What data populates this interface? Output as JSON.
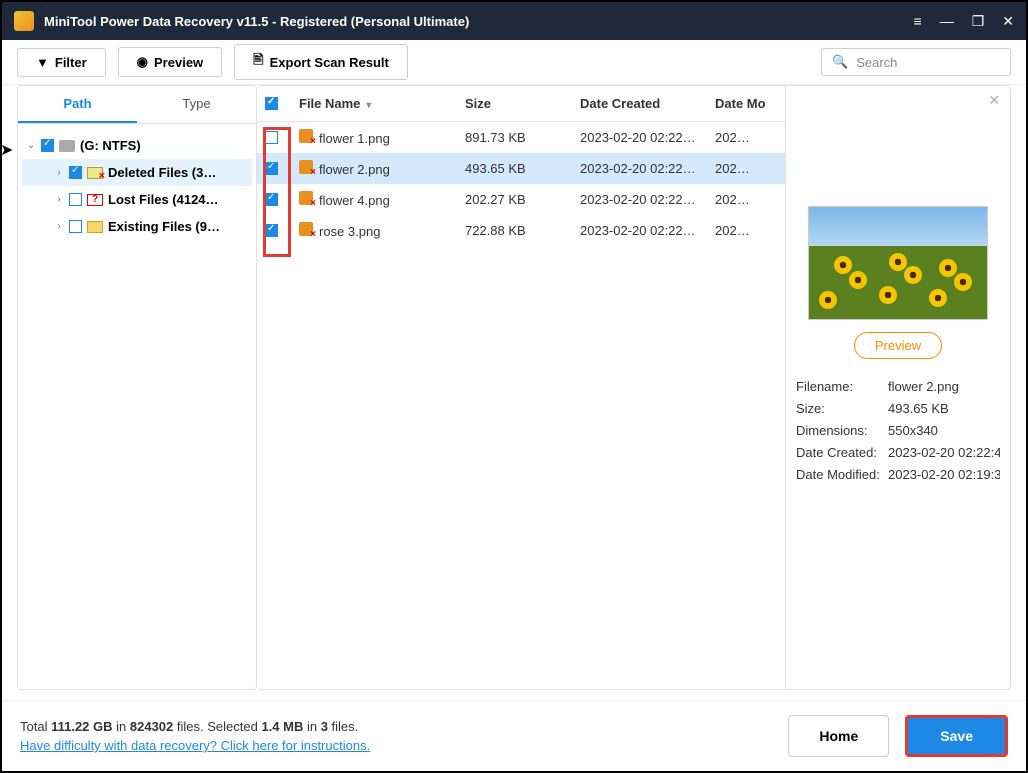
{
  "window": {
    "title": "MiniTool Power Data Recovery v11.5 - Registered (Personal Ultimate)"
  },
  "toolbar": {
    "filter": "Filter",
    "preview": "Preview",
    "export": "Export Scan Result"
  },
  "search": {
    "placeholder": "Search"
  },
  "sidebar": {
    "tabs": [
      "Path",
      "Type"
    ],
    "drive": "(G: NTFS)",
    "items": [
      "Deleted Files (3…",
      "Lost Files (4124…",
      "Existing Files (9…"
    ]
  },
  "columns": {
    "name": "File Name",
    "size": "Size",
    "created": "Date Created",
    "modified": "Date Mo"
  },
  "files": [
    {
      "checked": false,
      "name": "flower 1.png",
      "size": "891.73 KB",
      "created": "2023-02-20 02:22…",
      "modified": "202…"
    },
    {
      "checked": true,
      "name": "flower 2.png",
      "size": "493.65 KB",
      "created": "2023-02-20 02:22…",
      "modified": "202…",
      "selected": true
    },
    {
      "checked": true,
      "name": "flower 4.png",
      "size": "202.27 KB",
      "created": "2023-02-20 02:22…",
      "modified": "202…"
    },
    {
      "checked": true,
      "name": "rose 3.png",
      "size": "722.88 KB",
      "created": "2023-02-20 02:22…",
      "modified": "202…"
    }
  ],
  "detail": {
    "preview_btn": "Preview",
    "rows": [
      {
        "label": "Filename:",
        "value": "flower 2.png"
      },
      {
        "label": "Size:",
        "value": "493.65 KB"
      },
      {
        "label": "Dimensions:",
        "value": "550x340"
      },
      {
        "label": "Date Created:",
        "value": "2023-02-20 02:22:4"
      },
      {
        "label": "Date Modified:",
        "value": "2023-02-20 02:19:3"
      }
    ]
  },
  "footer": {
    "total_pre": "Total ",
    "total_size": "111.22 GB",
    "in": " in ",
    "total_files": "824302",
    "files_label": " files. ",
    "sel_pre": "Selected ",
    "sel_size": "1.4 MB",
    "sel_files": "3",
    "sel_suffix": " files.",
    "help": "Have difficulty with data recovery? Click here for instructions.",
    "home": "Home",
    "save": "Save"
  }
}
